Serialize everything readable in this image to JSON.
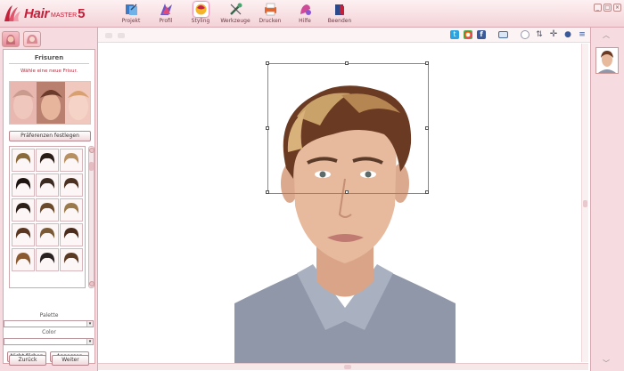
{
  "app": {
    "logo_main": "Hair",
    "logo_sub": "MASTER",
    "logo_num": "5"
  },
  "toolbar": {
    "items": [
      {
        "label": "Projekt",
        "icon": "project-icon"
      },
      {
        "label": "Profil",
        "icon": "profile-icon"
      },
      {
        "label": "Styling",
        "icon": "styling-icon"
      },
      {
        "label": "Werkzeuge",
        "icon": "tools-icon"
      },
      {
        "label": "Drucken",
        "icon": "print-icon"
      },
      {
        "label": "Hilfe",
        "icon": "help-icon"
      },
      {
        "label": "Beenden",
        "icon": "exit-icon"
      }
    ],
    "active": "Styling"
  },
  "window": {
    "minimize": "_",
    "maximize": "□",
    "close": "×"
  },
  "left": {
    "section_title": "Frisuren",
    "hint": "Wähle eine neue Frisur.",
    "prefs_button": "Präferenzen festlegen",
    "palette_label": "Palette",
    "color_label": "Color",
    "palette_value": "",
    "color_value": "",
    "nicht_button": "Nicht färben",
    "anpassen_button": "Anpassen",
    "back_button": "Zurück",
    "next_button": "Weiter"
  },
  "colors": {
    "accent": "#c4203a",
    "panel": "#f6dbe0",
    "border": "#d8a8b1"
  }
}
